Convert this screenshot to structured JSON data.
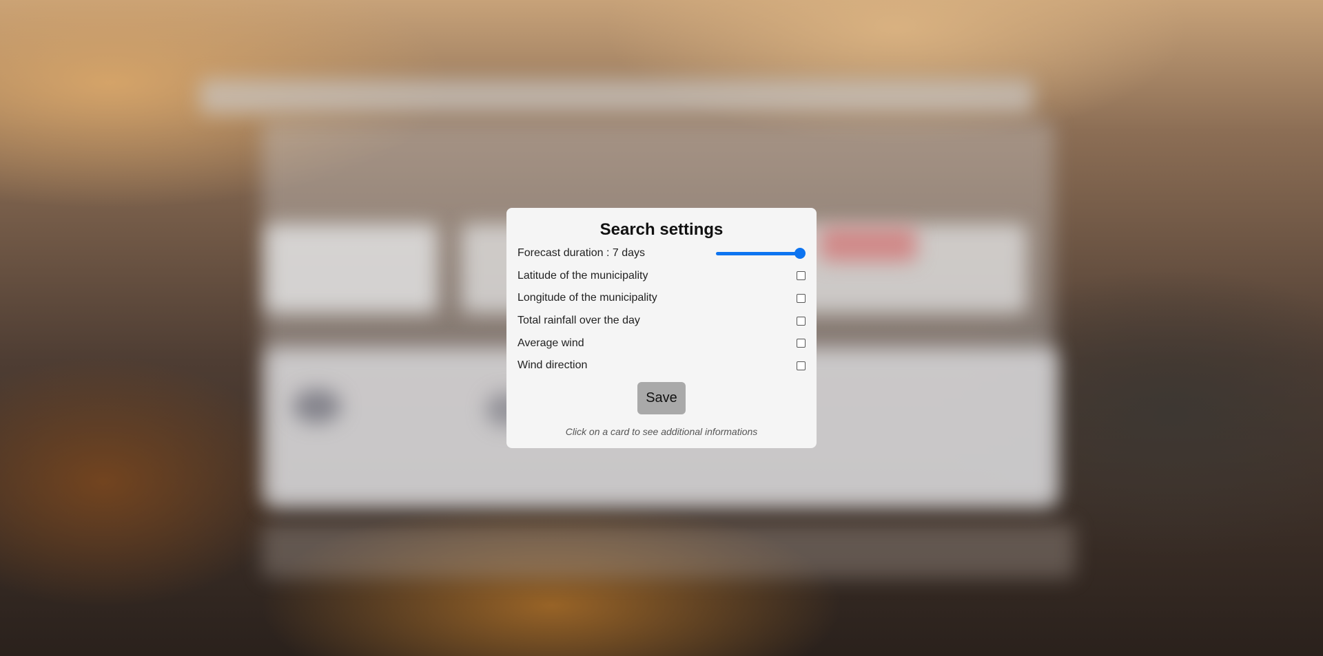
{
  "modal": {
    "title": "Search settings",
    "settings": [
      {
        "label": "Forecast duration : 7 days",
        "control": "slider",
        "value": 7,
        "max": 7
      },
      {
        "label": "Latitude of the municipality",
        "control": "checkbox",
        "checked": false
      },
      {
        "label": "Longitude of the municipality",
        "control": "checkbox",
        "checked": false
      },
      {
        "label": "Total rainfall over the day",
        "control": "checkbox",
        "checked": false
      },
      {
        "label": "Average wind",
        "control": "checkbox",
        "checked": false
      },
      {
        "label": "Wind direction",
        "control": "checkbox",
        "checked": false
      }
    ],
    "save_label": "Save",
    "hint": "Click on a card to see additional informations"
  },
  "colors": {
    "accent": "#0d74f0",
    "modal_background": "#f5f5f5",
    "save_button": "#a9a9a9"
  }
}
